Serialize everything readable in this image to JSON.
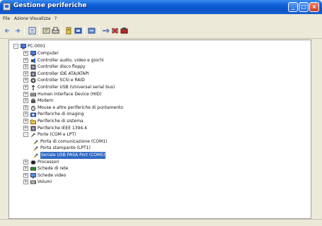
{
  "window": {
    "title": "Gestione periferiche"
  },
  "menu": [
    "File",
    "Azione",
    "Visualizza",
    "?"
  ],
  "tree": {
    "root": "PC-0001",
    "items": [
      {
        "label": "Computer",
        "level": 1,
        "expander": "+",
        "icon": "computer"
      },
      {
        "label": "Controller audio, video e giochi",
        "level": 1,
        "expander": "+",
        "icon": "speaker"
      },
      {
        "label": "Controller disco floppy",
        "level": 1,
        "expander": "+",
        "icon": "chip"
      },
      {
        "label": "Controller IDE ATA/ATAPI",
        "level": 1,
        "expander": "+",
        "icon": "chip"
      },
      {
        "label": "Controller SCSI e RAID",
        "level": 1,
        "expander": "+",
        "icon": "gear"
      },
      {
        "label": "Controller USB (Universal serial bus)",
        "level": 1,
        "expander": "+",
        "icon": "usb"
      },
      {
        "label": "Human Interface Device (HID)",
        "level": 1,
        "expander": "+",
        "icon": "keyboard"
      },
      {
        "label": "Modem",
        "level": 1,
        "expander": "+",
        "icon": "phone"
      },
      {
        "label": "Mouse e altre periferiche di puntamento",
        "level": 1,
        "expander": "+",
        "icon": "mouse"
      },
      {
        "label": "Periferiche di imaging",
        "level": 1,
        "expander": "+",
        "icon": "camera"
      },
      {
        "label": "Periferiche di sistema",
        "level": 1,
        "expander": "+",
        "icon": "folder"
      },
      {
        "label": "Periferiche IEEE 1394.4",
        "level": 1,
        "expander": "+",
        "icon": "chip"
      },
      {
        "label": "Porte (COM e LPT)",
        "level": 1,
        "expander": "-",
        "icon": "port"
      },
      {
        "label": "Porta di comunicazione (COM1)",
        "level": 2,
        "expander": "",
        "icon": "port"
      },
      {
        "label": "Porta stampante (LPT1)",
        "level": 2,
        "expander": "",
        "icon": "port"
      },
      {
        "label": "Seriale USB PASA Port (COM5)",
        "level": 2,
        "expander": "",
        "icon": "port",
        "selected": true
      },
      {
        "label": "Processori",
        "level": 1,
        "expander": "+",
        "icon": "cpu"
      },
      {
        "label": "Schede di rete",
        "level": 1,
        "expander": "+",
        "icon": "network"
      },
      {
        "label": "Schede video",
        "level": 1,
        "expander": "+",
        "icon": "monitor"
      },
      {
        "label": "Volumi",
        "level": 1,
        "expander": "+",
        "icon": "disk"
      }
    ]
  },
  "colors": {
    "titlebar": "#0a52c8",
    "selection": "#316ac5"
  }
}
